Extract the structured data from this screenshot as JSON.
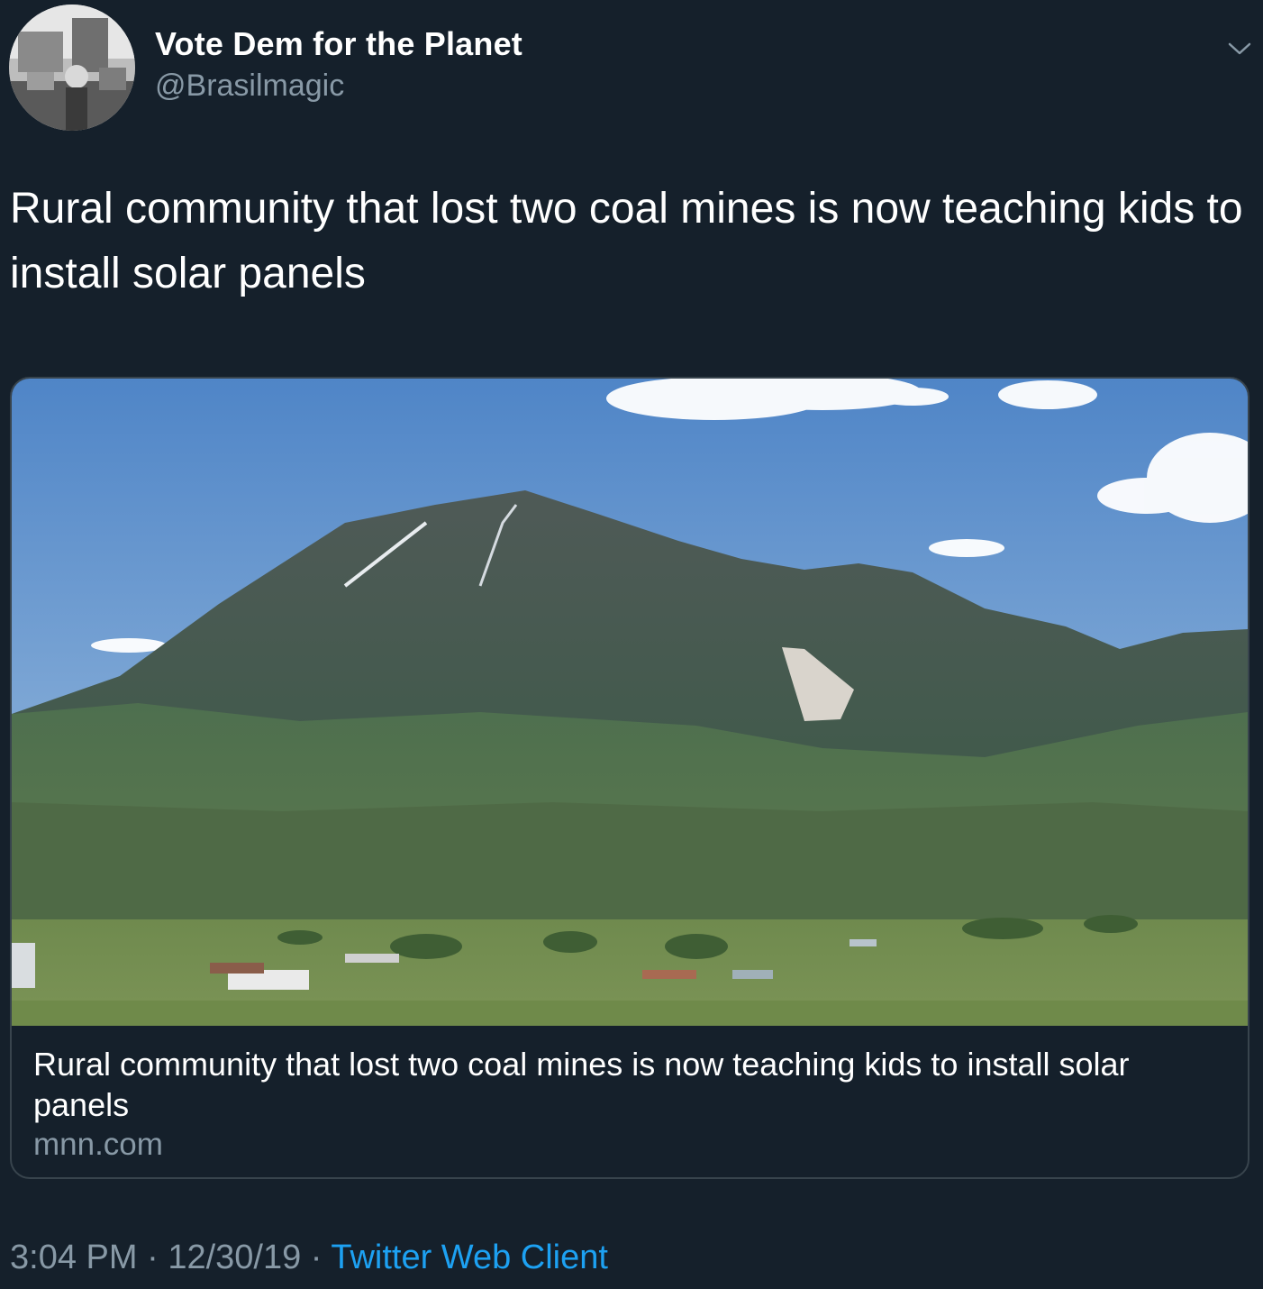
{
  "tweet": {
    "author": {
      "display_name": "Vote Dem for the Planet",
      "handle": "@Brasilmagic"
    },
    "menu_icon": "chevron-down-icon",
    "text": "Rural community that lost two coal mines is now teaching kids to install solar panels",
    "card": {
      "title": "Rural community that lost two coal mines is now teaching kids to install solar panels",
      "domain": "mnn.com"
    },
    "meta": {
      "time": "3:04 PM",
      "separator": "·",
      "date": "12/30/19",
      "source": "Twitter Web Client"
    }
  },
  "colors": {
    "background": "#15202b",
    "secondary_text": "#8899a6",
    "link": "#1da1f2",
    "card_border": "#38444d"
  }
}
